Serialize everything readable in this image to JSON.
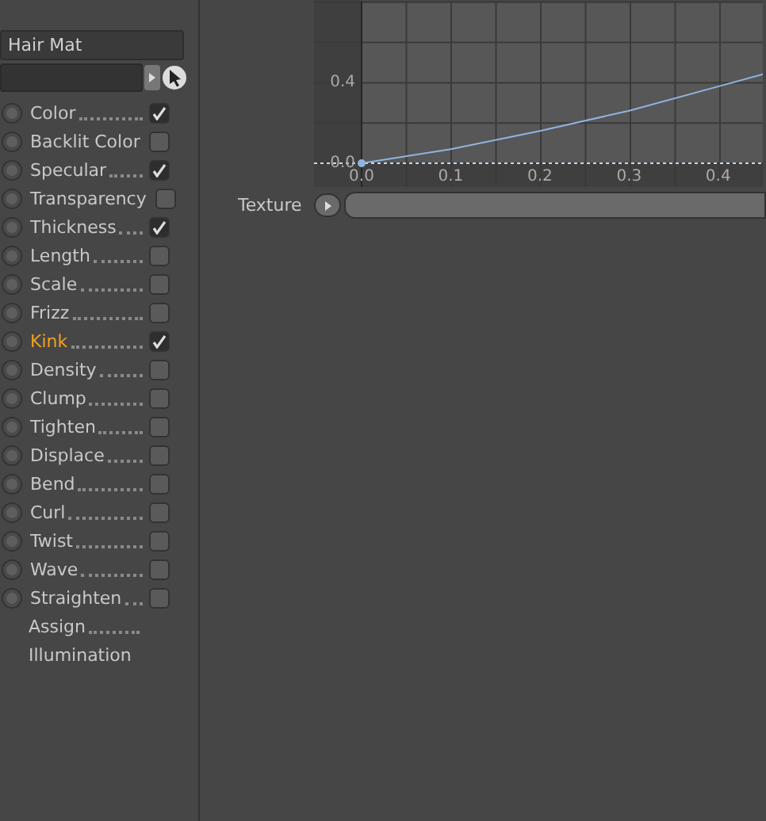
{
  "material_name": {
    "value": "Hair Mat"
  },
  "channels": [
    {
      "kind": "toggle",
      "label": "Color",
      "radio_on": false,
      "checked": true,
      "selected": false
    },
    {
      "kind": "toggle",
      "label": "Backlit Color",
      "radio_on": false,
      "checked": false,
      "selected": false
    },
    {
      "kind": "toggle",
      "label": "Specular",
      "radio_on": false,
      "checked": true,
      "selected": false
    },
    {
      "kind": "toggle",
      "label": "Transparency",
      "radio_on": false,
      "checked": false,
      "selected": false
    },
    {
      "kind": "toggle",
      "label": "Thickness",
      "radio_on": false,
      "checked": true,
      "selected": false
    },
    {
      "kind": "toggle",
      "label": "Length",
      "radio_on": false,
      "checked": false,
      "selected": false
    },
    {
      "kind": "toggle",
      "label": "Scale",
      "radio_on": false,
      "checked": false,
      "selected": false
    },
    {
      "kind": "toggle",
      "label": "Frizz",
      "radio_on": false,
      "checked": false,
      "selected": false
    },
    {
      "kind": "toggle",
      "label": "Kink",
      "radio_on": false,
      "checked": true,
      "selected": true
    },
    {
      "kind": "toggle",
      "label": "Density",
      "radio_on": false,
      "checked": false,
      "selected": false
    },
    {
      "kind": "toggle",
      "label": "Clump",
      "radio_on": false,
      "checked": false,
      "selected": false
    },
    {
      "kind": "toggle",
      "label": "Tighten",
      "radio_on": false,
      "checked": false,
      "selected": false
    },
    {
      "kind": "toggle",
      "label": "Displace",
      "radio_on": false,
      "checked": false,
      "selected": false
    },
    {
      "kind": "toggle",
      "label": "Bend",
      "radio_on": false,
      "checked": false,
      "selected": false
    },
    {
      "kind": "toggle",
      "label": "Curl",
      "radio_on": false,
      "checked": false,
      "selected": false
    },
    {
      "kind": "toggle",
      "label": "Twist",
      "radio_on": false,
      "checked": false,
      "selected": false
    },
    {
      "kind": "toggle",
      "label": "Wave",
      "radio_on": false,
      "checked": false,
      "selected": false
    },
    {
      "kind": "toggle",
      "label": "Straighten",
      "radio_on": false,
      "checked": false,
      "selected": false
    },
    {
      "kind": "plain",
      "label": "Assign",
      "selected": false
    },
    {
      "kind": "plain",
      "label": "Illumination",
      "selected": false
    }
  ],
  "curve": {
    "chart_data": {
      "type": "line",
      "x": [
        0,
        0.1,
        0.2,
        0.3,
        0.4,
        0.45
      ],
      "series": [
        {
          "color": "#8fb4e0",
          "values": [
            0,
            0.07,
            0.16,
            0.26,
            0.38,
            0.44
          ]
        }
      ],
      "xlim": [
        0,
        0.45
      ],
      "ylim": [
        0,
        0.8
      ],
      "yticks": [
        {
          "value": 0,
          "label": "0.0"
        },
        {
          "value": 0.4,
          "label": "0.4"
        }
      ],
      "xticks": [
        {
          "value": 0,
          "label": "0.0"
        },
        {
          "value": 0.1,
          "label": "0.1"
        },
        {
          "value": 0.2,
          "label": "0.2"
        },
        {
          "value": 0.3,
          "label": "0.3"
        },
        {
          "value": 0.4,
          "label": "0.4"
        }
      ],
      "grid": true
    }
  },
  "texture": {
    "label": "Texture"
  }
}
